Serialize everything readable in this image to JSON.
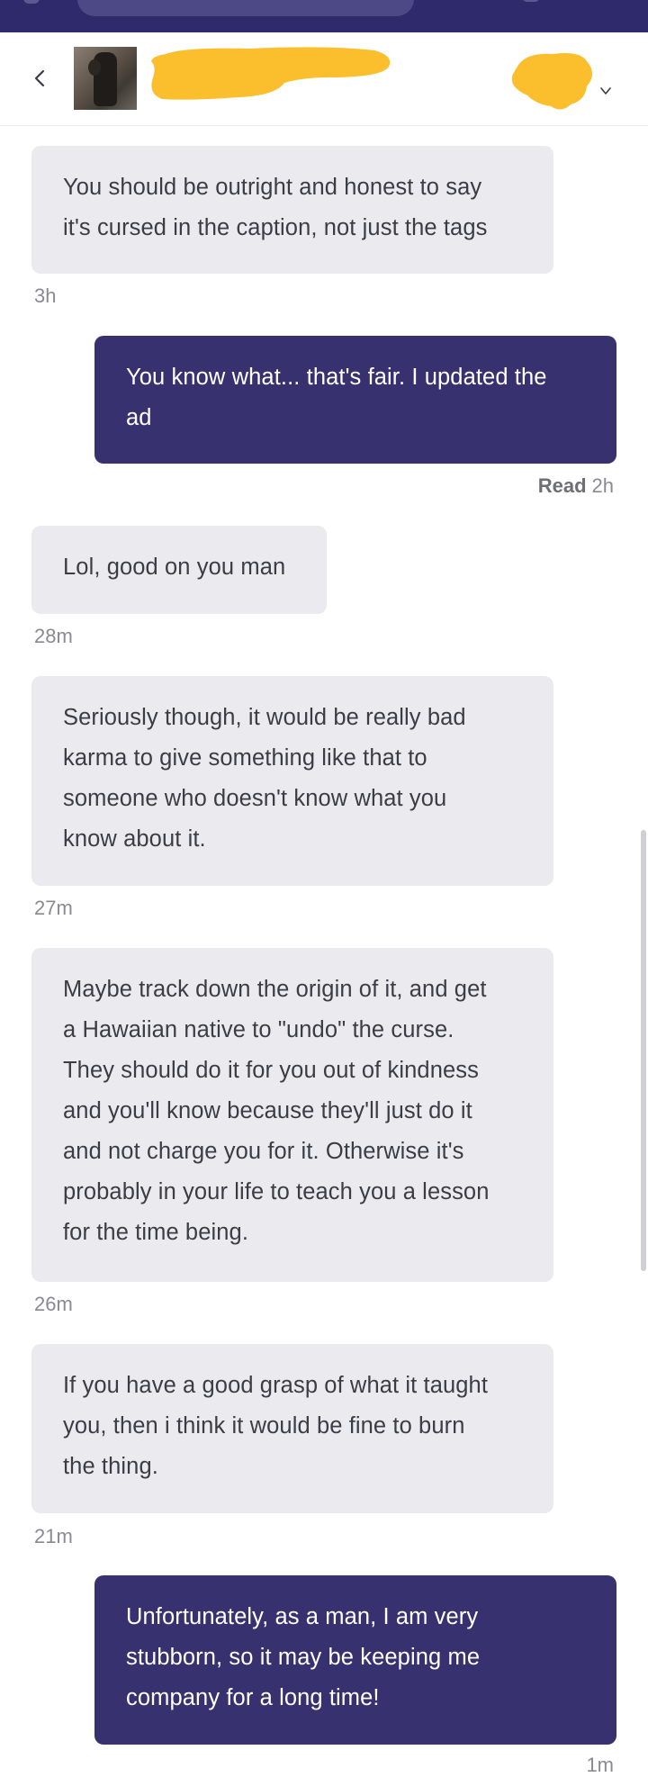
{
  "header": {
    "back_icon": "chevron-left-icon",
    "thumbnail": "listing-thumbnail-image",
    "user_name_redacted": true,
    "avatar_redacted": true,
    "menu_icon": "chevron-down-icon"
  },
  "colors": {
    "topbar": "#2e2a6b",
    "outgoing_bubble": "#37316f",
    "incoming_bubble": "#ebebef",
    "redaction": "#fbbf2e"
  },
  "messages": [
    {
      "direction": "in",
      "text": "You should be outright and honest to say it's cursed in the caption, not just the tags",
      "lines": [
        "You should be outright and honest to say",
        "it's cursed in the caption, not just the tags"
      ],
      "time": "3h"
    },
    {
      "direction": "out",
      "lines": [
        "You know what... that's fair.  I updated the",
        "ad"
      ],
      "read_label": "Read",
      "time": "2h"
    },
    {
      "direction": "in",
      "lines": [
        "Lol, good on you man"
      ],
      "time": "28m"
    },
    {
      "direction": "in",
      "lines": [
        "Seriously though, it would be really bad",
        "karma to give something like that to",
        "someone who doesn't know what you",
        "know about it."
      ],
      "time": "27m"
    },
    {
      "direction": "in",
      "lines": [
        "Maybe track down the origin of it, and get",
        "a Hawaiian native to \"undo\" the curse.",
        "They should do it for you out of kindness",
        "and you'll know because they'll just do it",
        "and not charge you for it. Otherwise it's",
        "probably in your life to teach you a lesson",
        "for the time being."
      ],
      "time": "26m"
    },
    {
      "direction": "in",
      "lines": [
        "If you have a good grasp of what it taught",
        "you, then i think it would be fine to burn",
        "the thing."
      ],
      "time": "21m"
    },
    {
      "direction": "out",
      "lines": [
        "Unfortunately, as a man, I am very",
        "stubborn, so it may be keeping me",
        "company for a long time!"
      ],
      "time": "1m"
    }
  ]
}
